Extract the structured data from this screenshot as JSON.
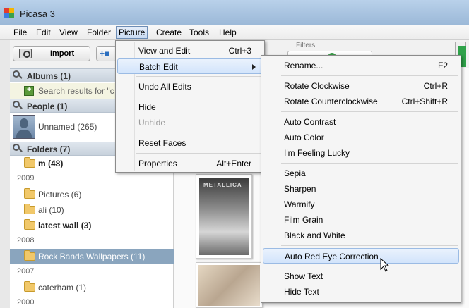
{
  "window": {
    "title": "Picasa 3"
  },
  "menubar": [
    "File",
    "Edit",
    "View",
    "Folder",
    "Picture",
    "Create",
    "Tools",
    "Help"
  ],
  "toolbar": {
    "import_label": "Import",
    "filters_label": "Filters"
  },
  "sidebar": {
    "albums_header": "Albums (1)",
    "search_results": "Search results for \"c",
    "people_header": "People (1)",
    "people_items": [
      {
        "label": "Unnamed (265)"
      }
    ],
    "folders_header": "Folders (7)",
    "folder_rows": [
      {
        "type": "folder",
        "label": "m (48)",
        "bold": true
      },
      {
        "type": "year",
        "label": "2009"
      },
      {
        "type": "folder",
        "label": "Pictures (6)"
      },
      {
        "type": "folder",
        "label": "ali (10)"
      },
      {
        "type": "folder",
        "label": "latest wall (3)",
        "bold": true
      },
      {
        "type": "year",
        "label": "2008"
      },
      {
        "type": "folder",
        "label": "Rock Bands Wallpapers (11)",
        "selected": true
      },
      {
        "type": "year",
        "label": "2007"
      },
      {
        "type": "folder",
        "label": "caterham (1)"
      },
      {
        "type": "year",
        "label": "2000"
      }
    ]
  },
  "photos": {
    "photo1_caption": "METALLICA"
  },
  "picture_menu": {
    "items": [
      {
        "label": "View and Edit",
        "shortcut": "Ctrl+3"
      },
      {
        "label": "Batch Edit",
        "submenu": true,
        "highlighted": true
      },
      {
        "separator": true
      },
      {
        "label": "Undo All Edits"
      },
      {
        "separator": true
      },
      {
        "label": "Hide"
      },
      {
        "label": "Unhide",
        "disabled": true
      },
      {
        "separator": true
      },
      {
        "label": "Reset Faces"
      },
      {
        "separator": true
      },
      {
        "label": "Properties",
        "shortcut": "Alt+Enter"
      }
    ]
  },
  "batch_menu": {
    "items": [
      {
        "label": "Rename...",
        "shortcut": "F2"
      },
      {
        "separator": true
      },
      {
        "label": "Rotate Clockwise",
        "shortcut": "Ctrl+R"
      },
      {
        "label": "Rotate Counterclockwise",
        "shortcut": "Ctrl+Shift+R"
      },
      {
        "separator": true
      },
      {
        "label": "Auto Contrast"
      },
      {
        "label": "Auto Color"
      },
      {
        "label": "I'm Feeling Lucky"
      },
      {
        "separator": true
      },
      {
        "label": "Sepia"
      },
      {
        "label": "Sharpen"
      },
      {
        "label": "Warmify"
      },
      {
        "label": "Film Grain"
      },
      {
        "label": "Black and White"
      },
      {
        "separator": true
      },
      {
        "label": "Auto Red Eye Correction",
        "highlighted": true
      },
      {
        "separator": true
      },
      {
        "label": "Show Text"
      },
      {
        "label": "Hide Text"
      }
    ]
  }
}
